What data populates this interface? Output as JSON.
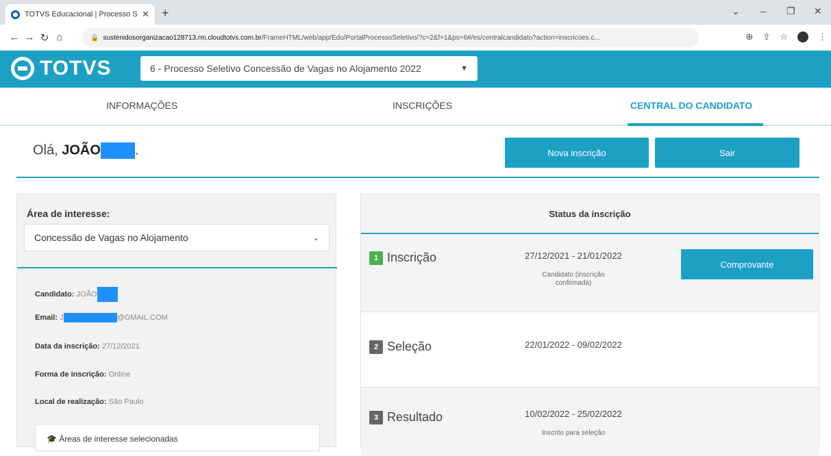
{
  "browser": {
    "tab_title": "TOTVS Educacional | Processo Se",
    "new_tab": "+",
    "url_host": "sustenidosorganizacao128713.rm.cloudtotvs.com.br",
    "url_path": "/FrameHTML/web/app/Edu/PortalProcessoSeletivo/?c=2&f=1&ps=6#/es/centralcandidato?action=inscricoes.c..."
  },
  "header": {
    "logo": "TOTVS",
    "process_selected": "6 - Processo Seletivo Concessão de Vagas no Alojamento 2022"
  },
  "nav": {
    "tabs": [
      {
        "label": "INFORMAÇÕES"
      },
      {
        "label": "INSCRIÇÕES"
      },
      {
        "label": "CENTRAL DO CANDIDATO"
      }
    ]
  },
  "greeting": {
    "hello": "Olá,",
    "name": "JOÃO",
    "trail": "."
  },
  "actions": {
    "new_label": "Nova inscrição",
    "exit_label": "Sair"
  },
  "left": {
    "area_label": "Área de interesse:",
    "area_value": "Concessão de Vagas no Alojamento",
    "rows": [
      {
        "key": "Candidato:",
        "value": "JOÃO"
      },
      {
        "key": "Email:",
        "value_pre": "J",
        "value_post": "@GMAIL.COM"
      },
      {
        "key": "Data da inscrição:",
        "value": "27/12/2021"
      },
      {
        "key": "Forma de inscrição:",
        "value": "Online"
      },
      {
        "key": "Local de realização:",
        "value": "São Paulo"
      }
    ],
    "areas_selected": "Áreas de interesse selecionadas"
  },
  "status": {
    "title": "Status da inscrição",
    "stages": [
      {
        "num": "1",
        "name": "Inscrição",
        "dates": "27/12/2021 - 21/01/2022",
        "status": "Candidato (inscrição confirmada)",
        "action": "Comprovante"
      },
      {
        "num": "2",
        "name": "Seleção",
        "dates": "22/01/2022 - 09/02/2022"
      },
      {
        "num": "3",
        "name": "Resultado",
        "dates": "10/02/2022 - 25/02/2022",
        "status": "Inscrito para seleção"
      }
    ]
  },
  "colors": {
    "primary": "#1ca0c4",
    "success": "#4cae4c",
    "redaction": "#1e90ff"
  }
}
